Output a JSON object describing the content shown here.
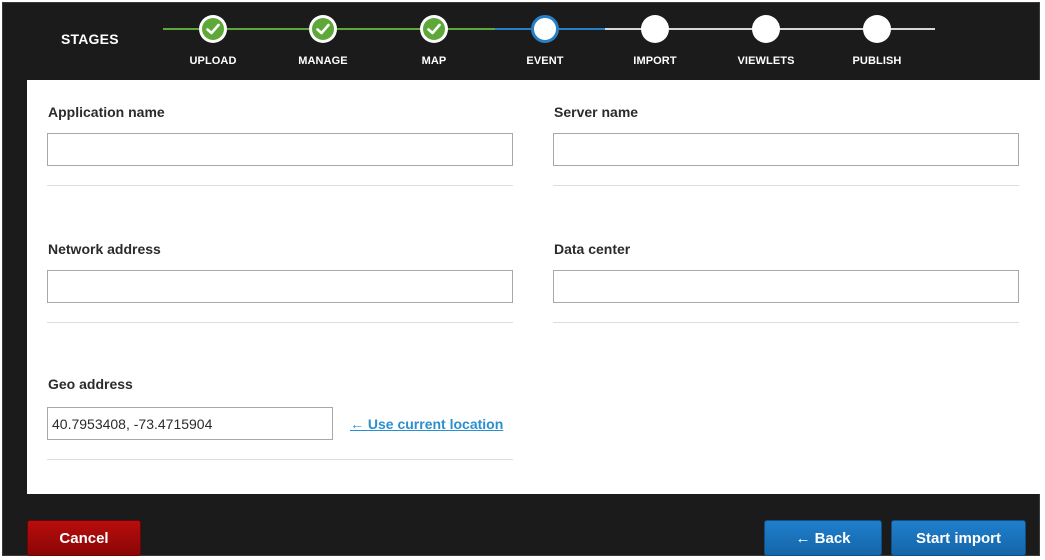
{
  "stages": {
    "title": "STAGES",
    "steps": [
      {
        "label": "UPLOAD",
        "status": "done"
      },
      {
        "label": "MANAGE",
        "status": "done"
      },
      {
        "label": "MAP",
        "status": "done"
      },
      {
        "label": "EVENT",
        "status": "current"
      },
      {
        "label": "IMPORT",
        "status": "pending"
      },
      {
        "label": "VIEWLETS",
        "status": "pending"
      },
      {
        "label": "PUBLISH",
        "status": "pending"
      }
    ],
    "colors": {
      "done": "#5ea83a",
      "current": "#2a7ec2",
      "pending": "#ffffff"
    }
  },
  "form": {
    "application_name": {
      "label": "Application name",
      "value": ""
    },
    "server_name": {
      "label": "Server name",
      "value": ""
    },
    "network_address": {
      "label": "Network address",
      "value": ""
    },
    "data_center": {
      "label": "Data center",
      "value": ""
    },
    "geo_address": {
      "label": "Geo address",
      "value": "40.7953408, -73.4715904"
    },
    "use_location_link": "← Use current location"
  },
  "footer": {
    "cancel_label": "Cancel",
    "back_label": "← Back",
    "start_label": "Start import"
  }
}
